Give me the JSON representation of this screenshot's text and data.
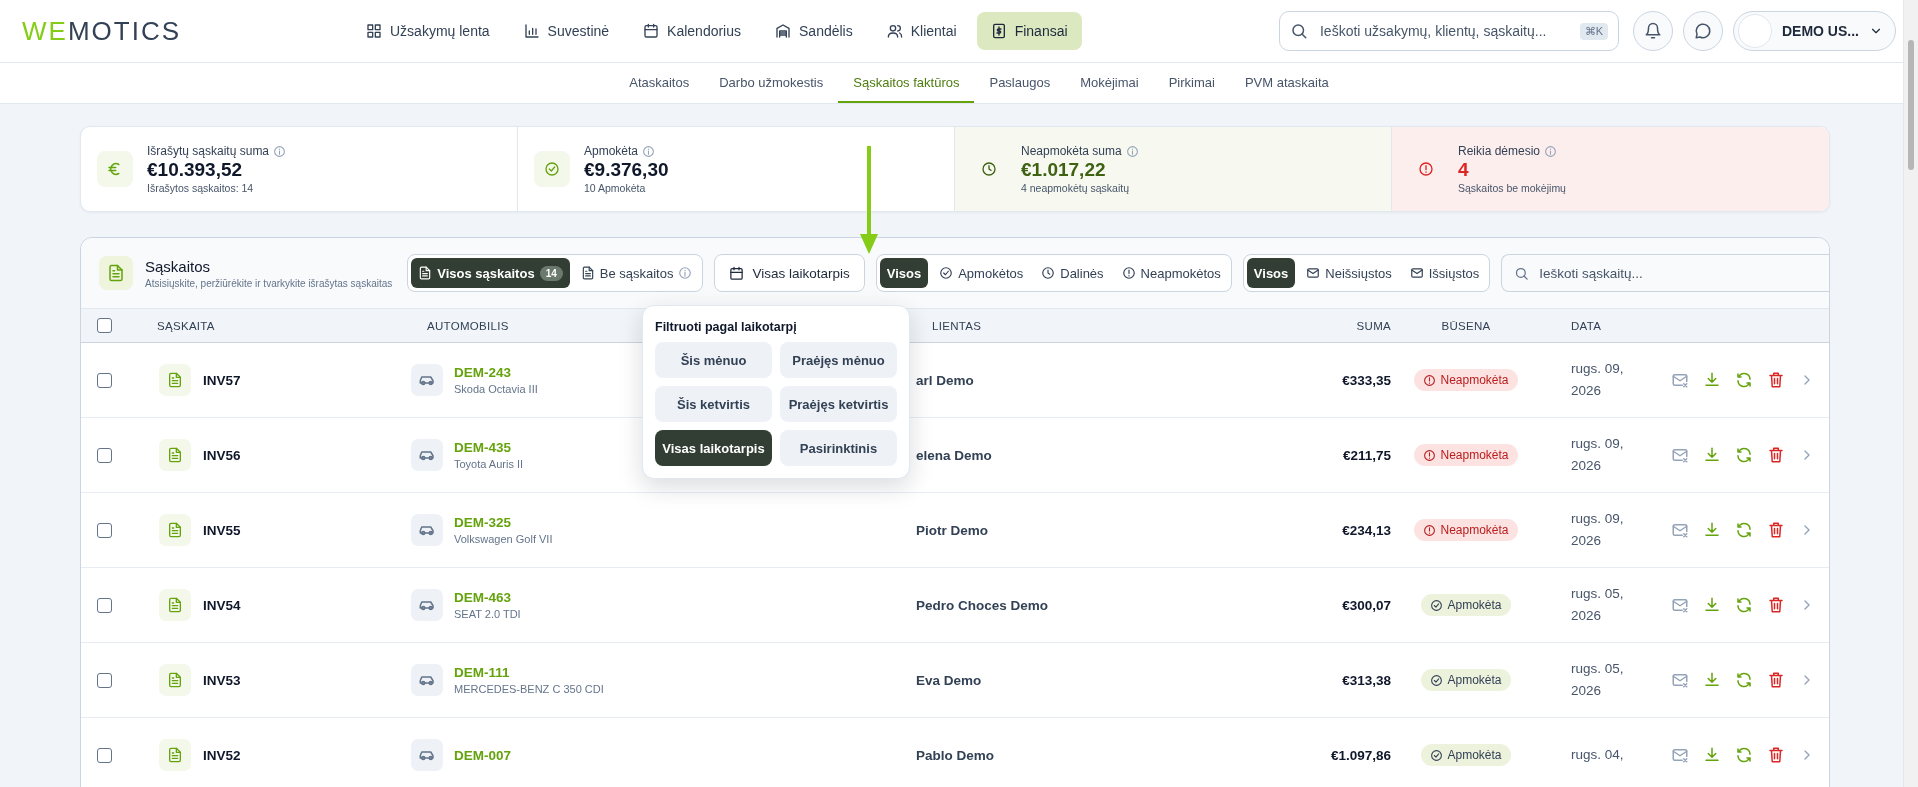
{
  "logo": {
    "accent": "WE",
    "rest": "MOTICS"
  },
  "nav": [
    {
      "label": "Užsakymų lenta",
      "selected": false
    },
    {
      "label": "Suvestinė",
      "selected": false
    },
    {
      "label": "Kalendorius",
      "selected": false
    },
    {
      "label": "Sandėlis",
      "selected": false
    },
    {
      "label": "Klientai",
      "selected": false
    },
    {
      "label": "Finansai",
      "selected": true
    }
  ],
  "search": {
    "placeholder": "Ieškoti užsakymų, klientų, sąskaitų...",
    "shortcut": "⌘K"
  },
  "user": {
    "name": "DEMO US..."
  },
  "subnav": [
    {
      "label": "Ataskaitos",
      "selected": false
    },
    {
      "label": "Darbo užmokestis",
      "selected": false
    },
    {
      "label": "Sąskaitos faktūros",
      "selected": true
    },
    {
      "label": "Paslaugos",
      "selected": false
    },
    {
      "label": "Mokėjimai",
      "selected": false
    },
    {
      "label": "Pirkimai",
      "selected": false
    },
    {
      "label": "PVM ataskaita",
      "selected": false
    }
  ],
  "stats": [
    {
      "kind": "total",
      "label": "Išrašytų sąskaitų suma",
      "value": "€10.393,52",
      "note": "Išrašytos sąskaitos: 14"
    },
    {
      "kind": "paid",
      "label": "Apmokėta",
      "value": "€9.376,30",
      "note": "10 Apmokėta"
    },
    {
      "kind": "unpaid",
      "label": "Neapmokėta suma",
      "value": "€1.017,22",
      "note": "4 neapmokėtų sąskaitų"
    },
    {
      "kind": "attention",
      "label": "Reikia dėmesio",
      "value": "4",
      "note": "Sąskaitos be mokėjimų"
    }
  ],
  "invoices": {
    "title": "Sąskaitos",
    "subtitle": "Atsisiųskite, peržiūrėkite ir tvarkykite išrašytas sąskaitas",
    "scope": [
      {
        "label": "Visos sąskaitos",
        "count": "14",
        "selected": true
      },
      {
        "label": "Be sąskaitos",
        "selected": false
      }
    ],
    "period": {
      "label": "Visas laikotarpis"
    },
    "payment_filter": [
      {
        "label": "Visos",
        "selected": true
      },
      {
        "label": "Apmokėtos",
        "selected": false
      },
      {
        "label": "Dalinės",
        "selected": false
      },
      {
        "label": "Neapmokėtos",
        "selected": false
      }
    ],
    "send_filter": [
      {
        "label": "Visos",
        "selected": true
      },
      {
        "label": "Neišsiųstos",
        "selected": false
      },
      {
        "label": "Išsiųstos",
        "selected": false
      }
    ],
    "search": {
      "placeholder": "Ieškoti sąskaitų..."
    },
    "select_all": {
      "checked": false
    },
    "columns": [
      "SĄSKAITA",
      "AUTOMOBILIS",
      "LIENTAS",
      "SUMA",
      "BŪSENA",
      "DATA"
    ],
    "rows": [
      {
        "checked": false,
        "number": "INV57",
        "plate": "DEM-243",
        "model": "Skoda Octavia III",
        "client": "arl Demo",
        "amount": "€333,35",
        "status": {
          "kind": "unpaid",
          "label": "Neapmokėta"
        },
        "date": "rugs. 09, 2026"
      },
      {
        "checked": false,
        "number": "INV56",
        "plate": "DEM-435",
        "model": "Toyota Auris II",
        "client": "elena Demo",
        "amount": "€211,75",
        "status": {
          "kind": "unpaid",
          "label": "Neapmokėta"
        },
        "date": "rugs. 09, 2026"
      },
      {
        "checked": false,
        "number": "INV55",
        "plate": "DEM-325",
        "model": "Volkswagen Golf VII",
        "client": "Piotr Demo",
        "amount": "€234,13",
        "status": {
          "kind": "unpaid",
          "label": "Neapmokėta"
        },
        "date": "rugs. 09, 2026"
      },
      {
        "checked": false,
        "number": "INV54",
        "plate": "DEM-463",
        "model": "SEAT 2.0 TDI",
        "client": "Pedro Choces Demo",
        "amount": "€300,07",
        "status": {
          "kind": "paid",
          "label": "Apmokėta"
        },
        "date": "rugs. 05, 2026"
      },
      {
        "checked": false,
        "number": "INV53",
        "plate": "DEM-111",
        "model": "MERCEDES-BENZ C 350 CDI",
        "client": "Eva Demo",
        "amount": "€313,38",
        "status": {
          "kind": "paid",
          "label": "Apmokėta"
        },
        "date": "rugs. 05, 2026"
      },
      {
        "checked": false,
        "number": "INV52",
        "plate": "DEM-007",
        "client": "Pablo Demo",
        "amount": "€1.097,86",
        "status": {
          "kind": "paid",
          "label": "Apmokėta"
        },
        "date": "rugs. 04,"
      }
    ],
    "period_menu": {
      "title": "Filtruoti pagal laikotarpį",
      "options": [
        {
          "label": "Šis mėnuo",
          "selected": false
        },
        {
          "label": "Praėjęs mėnuo",
          "selected": false
        },
        {
          "label": "Šis ketvirtis",
          "selected": false
        },
        {
          "label": "Praėjęs ketvirtis",
          "selected": false
        },
        {
          "label": "Visas laikotarpis",
          "selected": true
        },
        {
          "label": "Pasirinktinis",
          "selected": false
        }
      ]
    }
  }
}
